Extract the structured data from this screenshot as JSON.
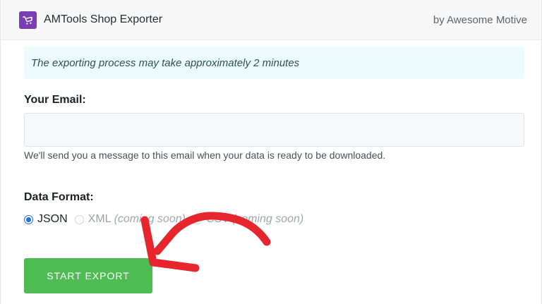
{
  "header": {
    "title": "AMTools Shop Exporter",
    "byline": "by Awesome Motive",
    "logo_icon": "shopping-cart-icon",
    "logo_color": "#7b3fb5"
  },
  "notice": {
    "text": "The exporting process may take approximately 2 minutes"
  },
  "email": {
    "label": "Your Email:",
    "value": "",
    "placeholder": "",
    "help": "We'll send you a message to this email when your data is ready to be downloaded."
  },
  "format": {
    "label": "Data Format:",
    "options": [
      {
        "label": "JSON",
        "note": "",
        "checked": true,
        "disabled": false
      },
      {
        "label": "XML",
        "note": "(coming soon)",
        "checked": false,
        "disabled": true
      },
      {
        "label": "CSV",
        "note": "(coming soon)",
        "checked": false,
        "disabled": true
      }
    ]
  },
  "export_button": {
    "label": "START EXPORT",
    "color": "#4fbb53"
  },
  "annotation": {
    "arrow_color": "#e6262c"
  }
}
